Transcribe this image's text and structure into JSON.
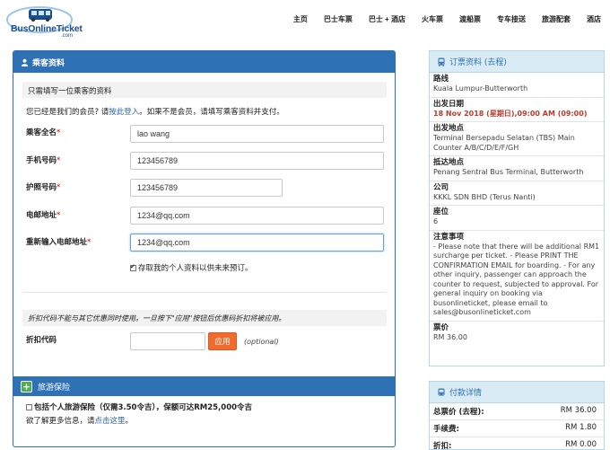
{
  "logo": {
    "text": "BusOnlineTicket",
    "sub": ".com"
  },
  "nav": [
    "主页",
    "巴士车票",
    "巴士 + 酒店",
    "火车票",
    "渡船票",
    "专车接送",
    "旅游配套",
    "酒店"
  ],
  "passenger": {
    "title": "乘客资料",
    "notice": "只需填写一位乘客的资料",
    "member_prefix": "您已经是我们的会员? 请",
    "member_link": "按此登入",
    "member_suffix": "。如果不是会员，请填写乘客资料并支付。",
    "fields": {
      "name_label": "乘客全名",
      "name_value": "lao wang",
      "phone_label": "手机号码",
      "phone_value": "123456789",
      "passport_label": "护照号码",
      "passport_value": "123456789",
      "email_label": "电邮地址",
      "email_value": "1234@qq.com",
      "email2_label": "重新输入电邮地址",
      "email2_value": "1234@qq.com"
    },
    "save_label": "存取我的个人资料以供未来预订。",
    "promo_note": "折扣代码不能与其它优惠同时使用。一旦按下\"应用\"按钮后优惠码折扣将被应用。",
    "promo_label": "折扣代码",
    "apply_label": "应用",
    "optional": "(optional)",
    "insurance_title": "旅游保险",
    "insurance_line": "包括个人旅游保险（仅需3.50令吉），保额可达RM25,000令吉",
    "insurance_more_prefix": "欲了解更多信息，请",
    "insurance_more_link": "点击这里",
    "insurance_more_suffix": "。"
  },
  "booking": {
    "title": "订票资料 (去程)",
    "route_label": "路线",
    "route": "Kuala Lumpur-Butterworth",
    "date_label": "出发日期",
    "date": "18 Nov 2018 (星期日),09:00 AM (09:00)",
    "dep_label": "出发地点",
    "dep": "Terminal Bersepadu Selatan (TBS) Main Counter A/B/C/D/E/F/GH",
    "arr_label": "抵达地点",
    "arr": "Penang Sentral Bus Terminal, Butterworth",
    "company_label": "公司",
    "company": "KKKL SDN BHD (Terus Nanti)",
    "seat_label": "座位",
    "seat": "6",
    "note_label": "注意事项",
    "note": "- Please note that there will be additional RM1 surcharge per ticket. - Please PRINT THE CONFIRMATION EMAIL for boarding. - For any other inquiry, passenger can approach the counter to request, subjected to approval. For general inquiry on booking via busonlineticket, please email to sales@busonlineticket.com",
    "fare_label": "票价",
    "fare": "RM 36.00"
  },
  "payment": {
    "title": "付款详情",
    "rows": [
      {
        "k": "总票价 (去程):",
        "v": "RM 36.00"
      },
      {
        "k": "手续费:",
        "v": "RM 1.80"
      },
      {
        "k": "折扣:",
        "v": "RM 0.00"
      }
    ]
  },
  "colors": {
    "primary": "#2f71b5",
    "apply": "#f06b2e",
    "date": "#c0392b"
  }
}
